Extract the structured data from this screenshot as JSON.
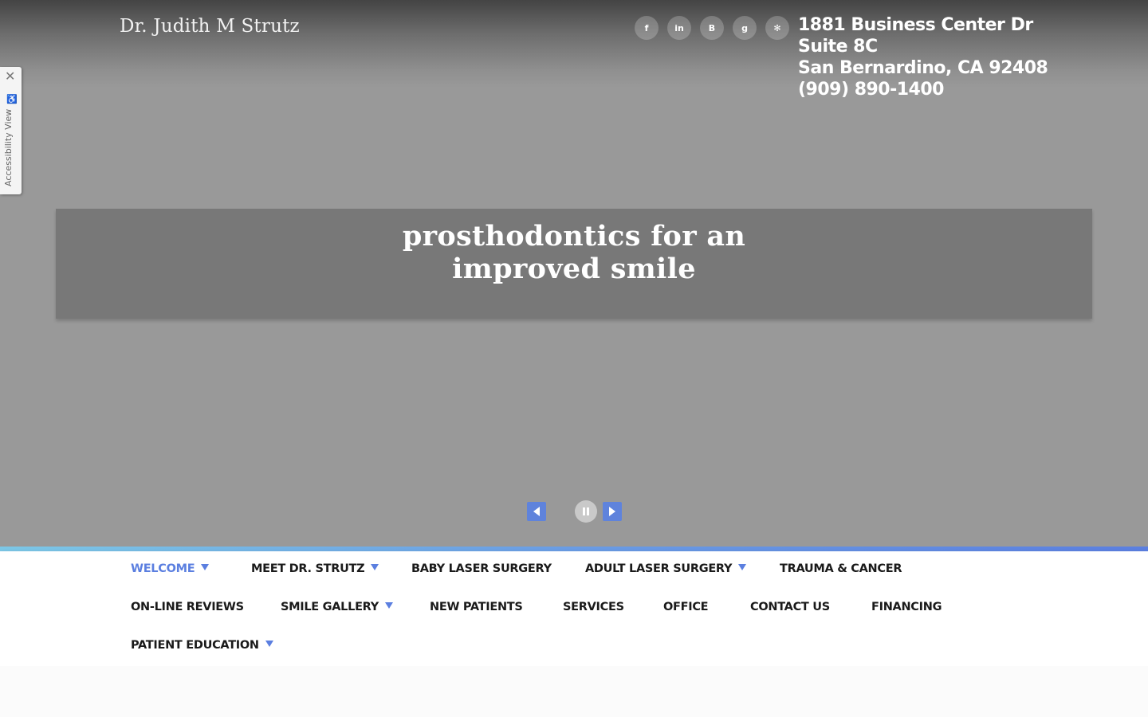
{
  "header": {
    "site_title": "Dr. Judith M Strutz",
    "address_line1": "1881 Business Center Dr",
    "address_line2": "Suite 8C",
    "address_line3": "San Bernardino, CA 92408",
    "phone": "(909) 890-1400"
  },
  "social": [
    {
      "icon": "facebook-icon",
      "glyph": "f"
    },
    {
      "icon": "linkedin-icon",
      "glyph": "in"
    },
    {
      "icon": "blogger-icon",
      "glyph": "B"
    },
    {
      "icon": "google-plus-icon",
      "glyph": "g"
    },
    {
      "icon": "yelp-icon",
      "glyph": "✻"
    }
  ],
  "accessibility": {
    "label": "Accessibility View",
    "close_glyph": "✕",
    "person_glyph": "♿"
  },
  "banner": {
    "line1": "prosthodontics for an",
    "line2": "improved smile"
  },
  "nav": {
    "items": [
      {
        "label": "WELCOME",
        "dropdown": true,
        "active": true
      },
      {
        "label": "MEET DR. STRUTZ",
        "dropdown": true
      },
      {
        "label": "BABY LASER SURGERY",
        "dropdown": false
      },
      {
        "label": "ADULT LASER SURGERY",
        "dropdown": true
      },
      {
        "label": "TRAUMA & CANCER",
        "dropdown": false
      },
      {
        "label": "ON-LINE REVIEWS",
        "dropdown": false
      },
      {
        "label": "SMILE GALLERY",
        "dropdown": true
      },
      {
        "label": "NEW PATIENTS",
        "dropdown": false
      },
      {
        "label": "SERVICES",
        "dropdown": false
      },
      {
        "label": "OFFICE",
        "dropdown": false
      },
      {
        "label": "CONTACT US",
        "dropdown": false
      },
      {
        "label": "FINANCING",
        "dropdown": false
      },
      {
        "label": "PATIENT EDUCATION",
        "dropdown": true
      }
    ]
  },
  "colors": {
    "accent": "#5b7fe0",
    "hero_gray": "#999999",
    "banner_gray": "#787878"
  }
}
